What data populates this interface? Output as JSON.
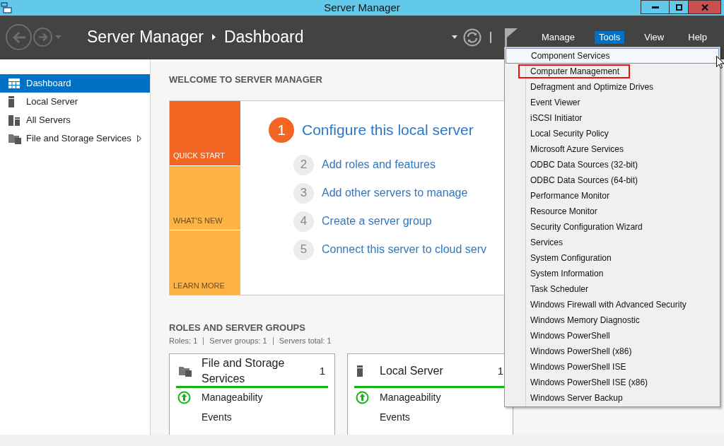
{
  "window": {
    "title": "Server Manager"
  },
  "header": {
    "breadcrumb": [
      "Server Manager",
      "Dashboard"
    ],
    "menus": [
      {
        "label": "Manage",
        "selected": false
      },
      {
        "label": "Tools",
        "selected": true
      },
      {
        "label": "View",
        "selected": false
      },
      {
        "label": "Help",
        "selected": false
      }
    ]
  },
  "sidebar": {
    "items": [
      {
        "label": "Dashboard",
        "kind": "dashboard",
        "selected": true,
        "expandable": false
      },
      {
        "label": "Local Server",
        "kind": "server",
        "selected": false,
        "expandable": false
      },
      {
        "label": "All Servers",
        "kind": "servers",
        "selected": false,
        "expandable": false
      },
      {
        "label": "File and Storage Services",
        "kind": "storage",
        "selected": false,
        "expandable": true
      }
    ]
  },
  "welcome": {
    "heading": "WELCOME TO SERVER MANAGER",
    "tiles": [
      {
        "label": "QUICK START",
        "selected": true
      },
      {
        "label": "WHAT'S NEW",
        "selected": false
      },
      {
        "label": "LEARN MORE",
        "selected": false
      }
    ],
    "steps": [
      {
        "number": "1",
        "label": "Configure this local server",
        "primary": true
      },
      {
        "number": "2",
        "label": "Add roles and features",
        "primary": false
      },
      {
        "number": "3",
        "label": "Add other servers to manage",
        "primary": false
      },
      {
        "number": "4",
        "label": "Create a server group",
        "primary": false
      },
      {
        "number": "5",
        "label": "Connect this server to cloud serv",
        "primary": false
      }
    ]
  },
  "roles": {
    "heading": "ROLES AND SERVER GROUPS",
    "summary": [
      "Roles: 1",
      "Server groups: 1",
      "Servers total: 1"
    ],
    "cards": [
      {
        "kind": "storage",
        "title": "File and Storage Services",
        "count": "1",
        "rows": [
          {
            "label": "Manageability",
            "kind": "status"
          },
          {
            "label": "Events",
            "kind": "plain"
          }
        ]
      },
      {
        "kind": "server",
        "title": "Local Server",
        "count": "1",
        "rows": [
          {
            "label": "Manageability",
            "kind": "status"
          },
          {
            "label": "Events",
            "kind": "plain"
          }
        ]
      }
    ]
  },
  "tools_menu": {
    "items": [
      {
        "label": "Component Services",
        "hovered": true,
        "marked": false
      },
      {
        "label": "Computer Management",
        "hovered": false,
        "marked": true
      },
      {
        "label": "Defragment and Optimize Drives",
        "hovered": false,
        "marked": false
      },
      {
        "label": "Event Viewer",
        "hovered": false,
        "marked": false
      },
      {
        "label": "iSCSI Initiator",
        "hovered": false,
        "marked": false
      },
      {
        "label": "Local Security Policy",
        "hovered": false,
        "marked": false
      },
      {
        "label": "Microsoft Azure Services",
        "hovered": false,
        "marked": false
      },
      {
        "label": "ODBC Data Sources (32-bit)",
        "hovered": false,
        "marked": false
      },
      {
        "label": "ODBC Data Sources (64-bit)",
        "hovered": false,
        "marked": false
      },
      {
        "label": "Performance Monitor",
        "hovered": false,
        "marked": false
      },
      {
        "label": "Resource Monitor",
        "hovered": false,
        "marked": false
      },
      {
        "label": "Security Configuration Wizard",
        "hovered": false,
        "marked": false
      },
      {
        "label": "Services",
        "hovered": false,
        "marked": false
      },
      {
        "label": "System Configuration",
        "hovered": false,
        "marked": false
      },
      {
        "label": "System Information",
        "hovered": false,
        "marked": false
      },
      {
        "label": "Task Scheduler",
        "hovered": false,
        "marked": false
      },
      {
        "label": "Windows Firewall with Advanced Security",
        "hovered": false,
        "marked": false
      },
      {
        "label": "Windows Memory Diagnostic",
        "hovered": false,
        "marked": false
      },
      {
        "label": "Windows PowerShell",
        "hovered": false,
        "marked": false
      },
      {
        "label": "Windows PowerShell (x86)",
        "hovered": false,
        "marked": false
      },
      {
        "label": "Windows PowerShell ISE",
        "hovered": false,
        "marked": false
      },
      {
        "label": "Windows PowerShell ISE (x86)",
        "hovered": false,
        "marked": false
      },
      {
        "label": "Windows Server Backup",
        "hovered": false,
        "marked": false
      }
    ]
  }
}
